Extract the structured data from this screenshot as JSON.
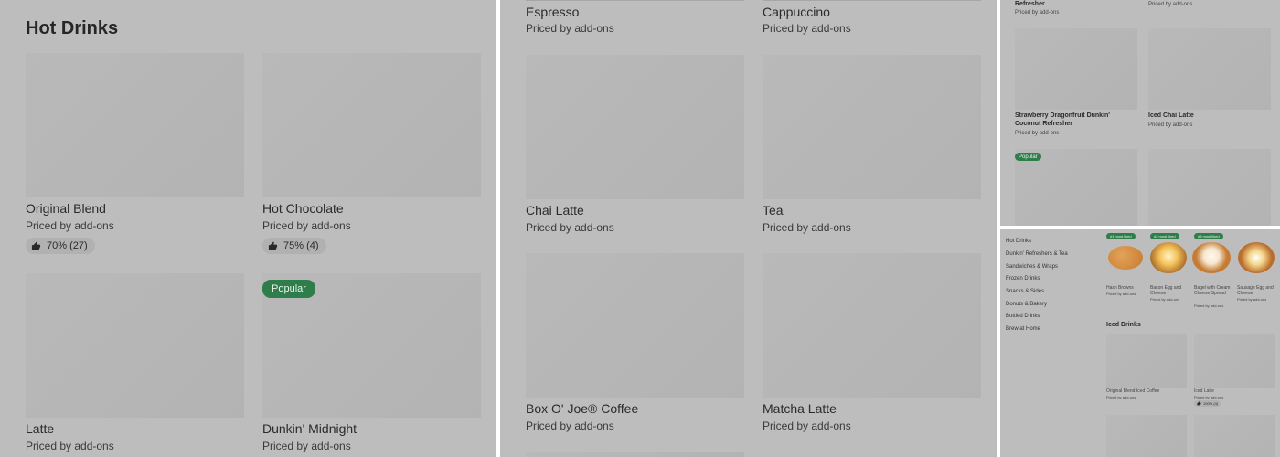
{
  "panel_a": {
    "section_title": "Hot Drinks",
    "items": [
      {
        "name": "Original Blend",
        "price": "Priced by add-ons",
        "rating": "70% (27)"
      },
      {
        "name": "Hot Chocolate",
        "price": "Priced by add-ons",
        "rating": "75% (4)"
      },
      {
        "name": "Latte",
        "price": "Priced by add-ons"
      },
      {
        "name": "Dunkin' Midnight",
        "price": "Priced by add-ons",
        "badge": "Popular"
      }
    ]
  },
  "panel_b": {
    "items": [
      {
        "name": "Espresso",
        "price": "Priced by add-ons"
      },
      {
        "name": "Cappuccino",
        "price": "Priced by add-ons"
      },
      {
        "name": "Chai Latte",
        "price": "Priced by add-ons"
      },
      {
        "name": "Tea",
        "price": "Priced by add-ons"
      },
      {
        "name": "Box O' Joe® Coffee",
        "price": "Priced by add-ons"
      },
      {
        "name": "Matcha Latte",
        "price": "Priced by add-ons"
      }
    ]
  },
  "panel_c": {
    "top_left_title": "Refresher",
    "top_left_price": "Priced by add-ons",
    "top_right_price": "Priced by add-ons",
    "items": [
      {
        "name": "Strawberry Dragonfruit Dunkin' Coconut Refresher",
        "price": "Priced by add-ons"
      },
      {
        "name": "Iced Chai Latte",
        "price": "Priced by add-ons"
      }
    ],
    "badge": "Popular"
  },
  "panel_d": {
    "sidebar": [
      "Hot Drinks",
      "Dunkin' Refreshers & Tea",
      "Sandwiches & Wraps",
      "Frozen Drinks",
      "Snacks & Sides",
      "Donuts & Bakery",
      "Bottled Drinks",
      "Brew at Home"
    ],
    "top_items": [
      {
        "name": "Hash Browns",
        "price": "Priced by add-ons",
        "badge": "#1 most liked"
      },
      {
        "name": "Bacon Egg and Cheese",
        "price": "Priced by add-ons",
        "badge": "#2 most liked"
      },
      {
        "name": "Bagel with Cream Cheese Spread",
        "price": "Priced by add-ons",
        "badge": "#3 most liked"
      },
      {
        "name": "Sausage Egg and Cheese",
        "price": "Priced by add-ons"
      }
    ],
    "section_title": "Iced Drinks",
    "iced_items": [
      {
        "name": "Original Blend Iced Coffee",
        "price": "Priced by add-ons"
      },
      {
        "name": "Iced Latte",
        "price": "Priced by add-ons",
        "rating": "100% (4)"
      }
    ]
  },
  "colors": {
    "badge_green": "#2f7d4a",
    "overlay_gray": "#bdbdbd"
  },
  "icons": {
    "rating": "thumbs-up-icon"
  }
}
